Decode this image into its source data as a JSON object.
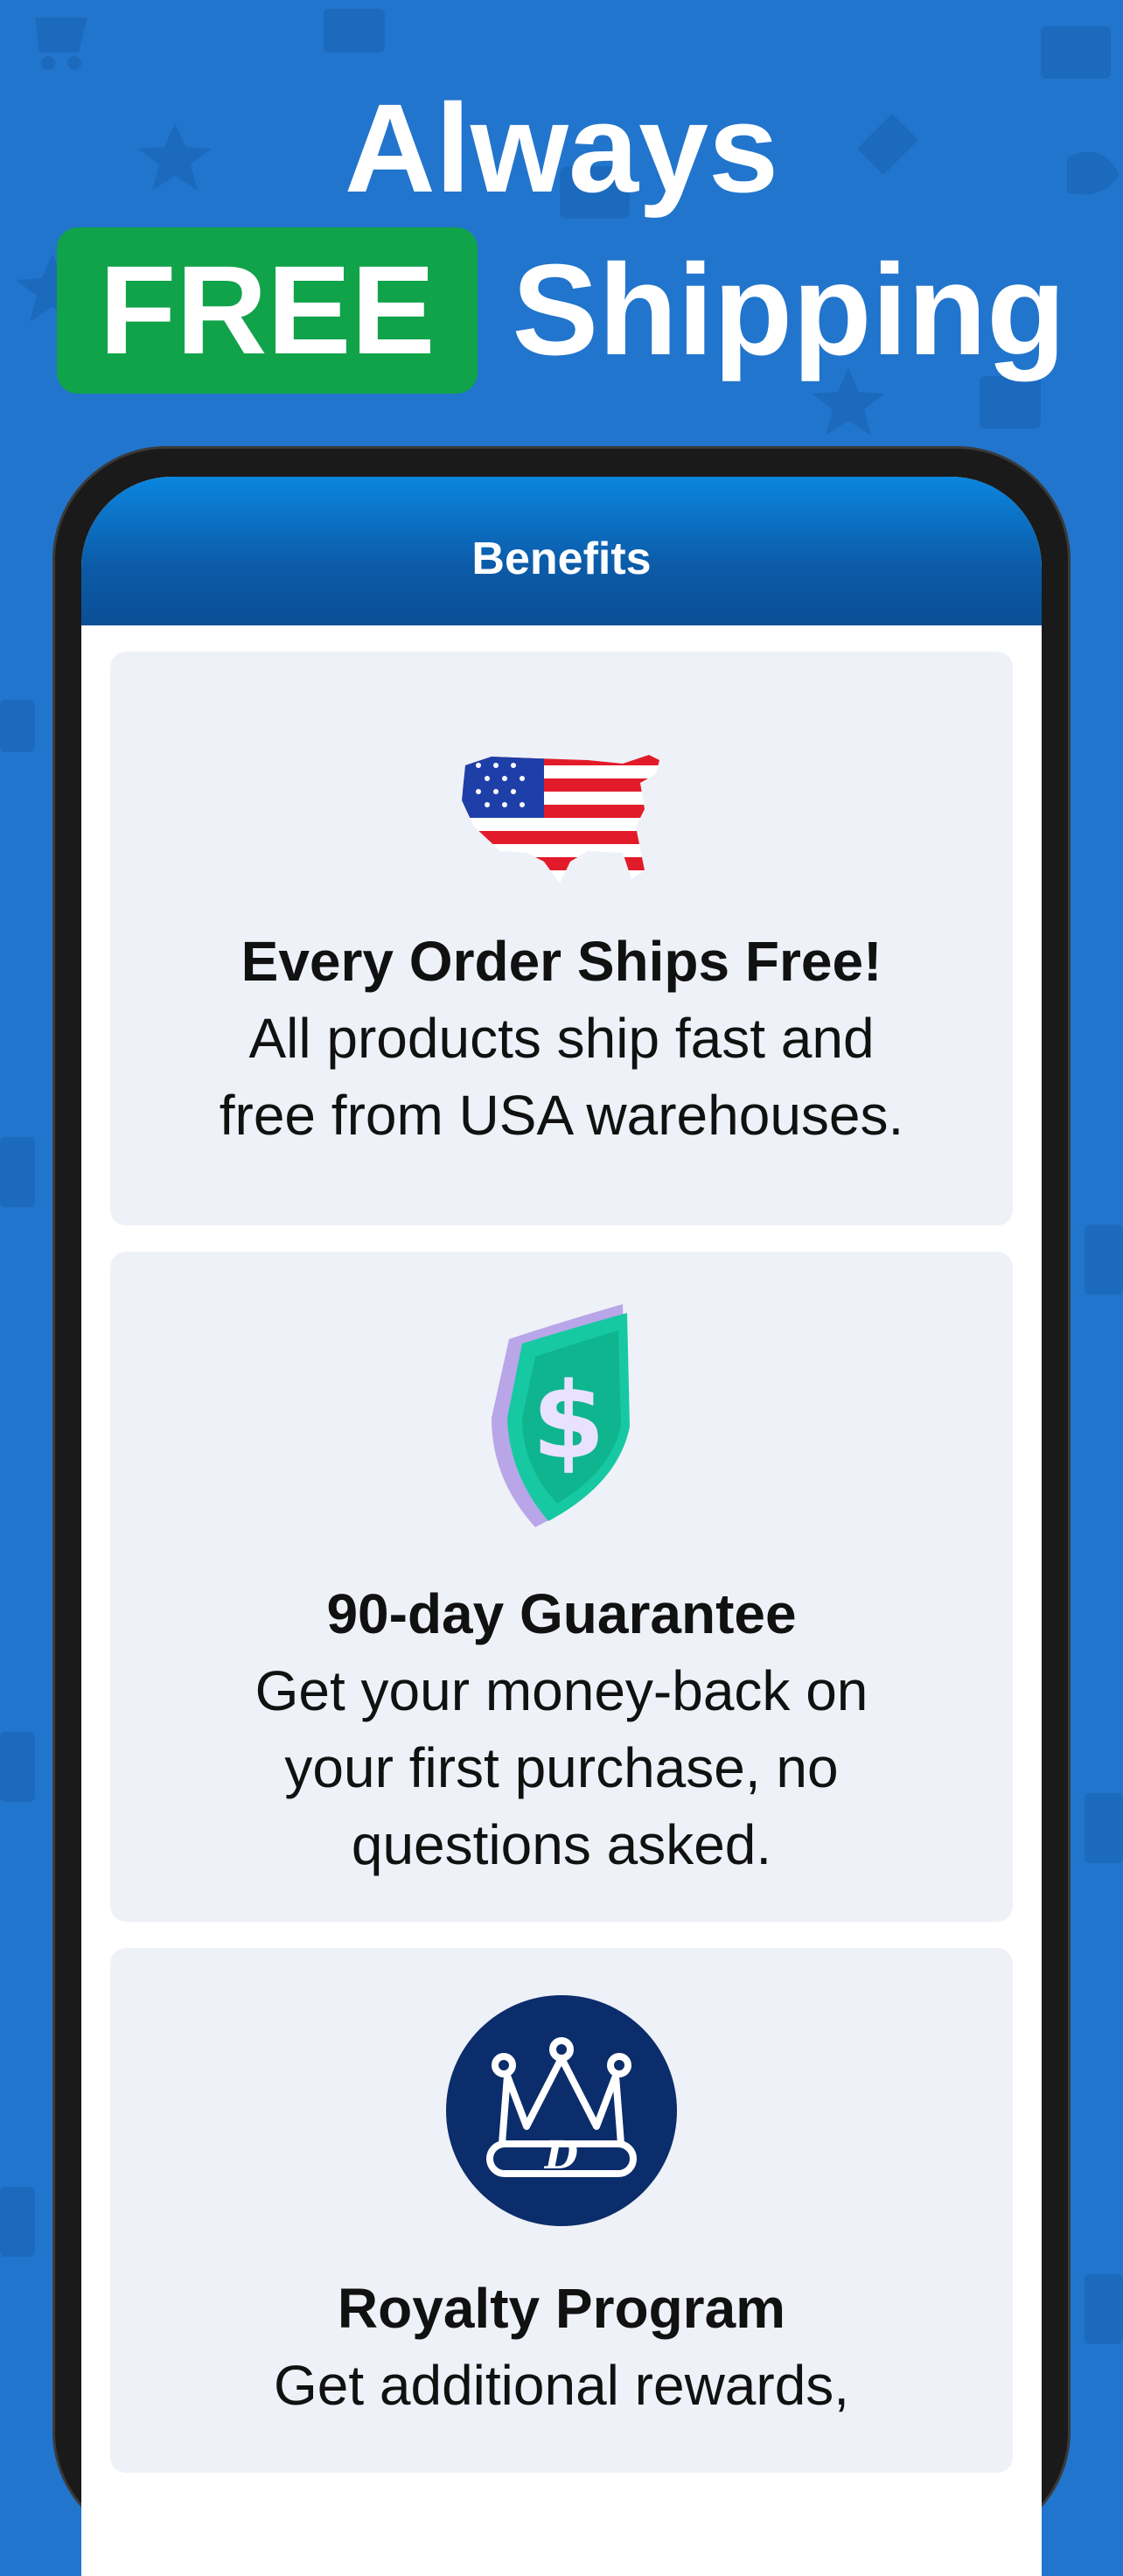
{
  "headline": {
    "line1": "Always",
    "free_badge": "FREE",
    "line2_rest": "Shipping"
  },
  "screen": {
    "header_title": "Benefits"
  },
  "benefits": [
    {
      "icon": "usa-flag-map-icon",
      "title": "Every Order Ships Free!",
      "desc_lines": [
        "All products ship fast and",
        "free from USA warehouses."
      ]
    },
    {
      "icon": "dollar-shield-icon",
      "title": "90-day Guarantee",
      "desc_lines": [
        "Get your money-back on",
        "your first purchase, no",
        "questions asked."
      ]
    },
    {
      "icon": "crown-d-icon",
      "title": "Royalty Program",
      "desc_lines": [
        "Get additional rewards,"
      ]
    }
  ],
  "colors": {
    "background": "#2275cc",
    "free_badge": "#11a34a",
    "card": "#eef1f7",
    "royalty_circle": "#0c2d6b"
  }
}
